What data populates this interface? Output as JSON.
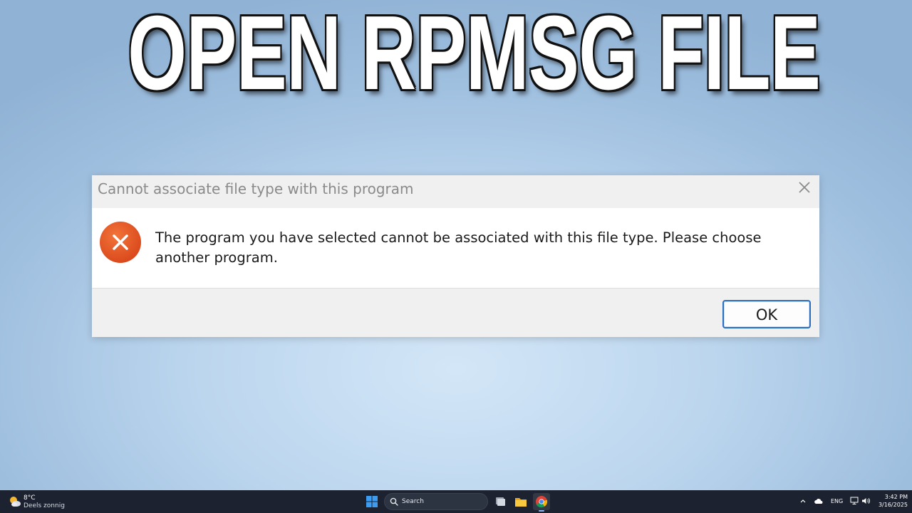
{
  "headline": "OPEN RPMSG FILE",
  "dialog": {
    "title": "Cannot associate file type with this program",
    "message": "The program you have selected cannot be associated with this file type. Please choose another program.",
    "ok_label": "OK",
    "icon": "error-icon",
    "colors": {
      "error_icon": "#e0501f",
      "ok_border": "#2a6ebd"
    }
  },
  "taskbar": {
    "weather": {
      "temp": "8°C",
      "desc": "Deels zonnig",
      "icon": "partly-sunny-icon"
    },
    "search": {
      "label": "Search"
    },
    "apps": [
      {
        "name": "task-view",
        "icon": "task-view-icon"
      },
      {
        "name": "file-explorer",
        "icon": "folder-icon"
      },
      {
        "name": "chrome",
        "icon": "chrome-icon"
      }
    ],
    "tray": {
      "language": "ENG"
    },
    "clock": {
      "time": "3:42 PM",
      "date": "3/16/2025"
    }
  }
}
